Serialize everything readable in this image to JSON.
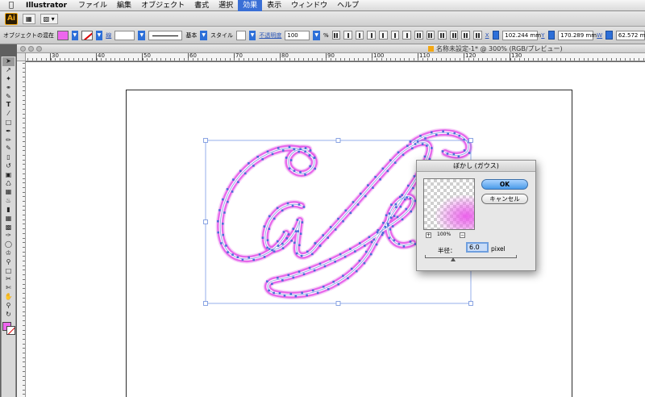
{
  "menubar": {
    "app_name": "Illustrator",
    "menus": [
      "ファイル",
      "編集",
      "オブジェクト",
      "書式",
      "選択",
      "効果",
      "表示",
      "ウィンドウ",
      "ヘルプ"
    ],
    "active_menu_index": 5
  },
  "appbar": {
    "logo": "Ai"
  },
  "control_bar": {
    "object_label": "オブジェクトの混在",
    "stroke_label": "線",
    "stroke_style": "基本",
    "style_label": "スタイル",
    "opacity_label": "不透明度",
    "opacity_value": "100",
    "opacity_unit": "%",
    "x_label": "X",
    "x_value": "102.244 mm",
    "y_label": "Y",
    "y_value": "170.289 mm",
    "w_label": "W",
    "w_value": "62.572 mm",
    "fill_color": "#ee66ee"
  },
  "document": {
    "title": "名称未設定-1* @ 300% (RGB/プレビュー)",
    "ruler_labels": [
      "30",
      "40",
      "50",
      "60",
      "70",
      "80",
      "90",
      "100",
      "110",
      "120",
      "130"
    ]
  },
  "artwork": {
    "text": "Cafe",
    "stroke_color": "#e45de9",
    "highlight_color": "#ffffff",
    "anchor_color": "#4a6fd8"
  },
  "dialog": {
    "title": "ぼかし (ガウス)",
    "ok_label": "OK",
    "cancel_label": "キャンセル",
    "zoom_level": "100%",
    "zoom_in": "+",
    "zoom_out": "−",
    "radius_label": "半径：",
    "radius_value": "6.0",
    "radius_unit": "pixel"
  },
  "toolbox": {
    "tools": [
      "selection-tool",
      "direct-selection-tool",
      "magic-wand-tool",
      "lasso-tool",
      "pen-tool",
      "type-tool",
      "line-tool",
      "rectangle-tool",
      "paintbrush-tool",
      "pencil-tool",
      "blob-brush-tool",
      "eraser-tool",
      "rotate-tool",
      "scale-tool",
      "warp-tool",
      "free-transform-tool",
      "symbol-sprayer-tool",
      "column-graph-tool",
      "mesh-tool",
      "gradient-tool",
      "eyedropper-tool",
      "blend-tool",
      "live-paint-tool",
      "live-paint-selection-tool",
      "artboard-tool",
      "slice-tool",
      "hand-tool",
      "zoom-tool"
    ]
  }
}
